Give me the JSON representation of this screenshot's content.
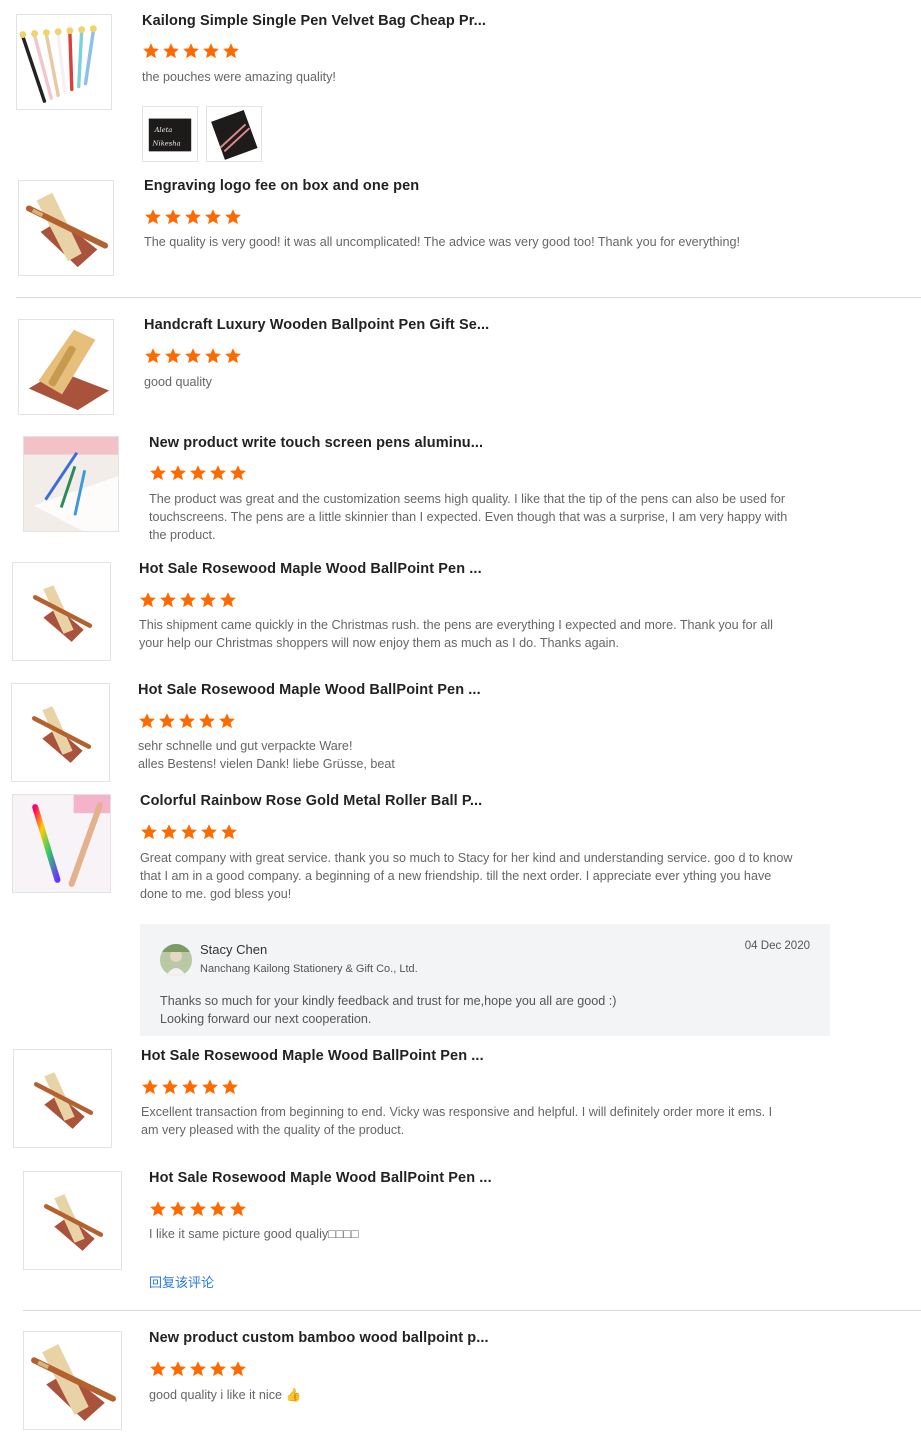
{
  "reviews": [
    {
      "title": "Kailong Simple Single Pen Velvet Bag Cheap Pr...",
      "rating": 5,
      "text": "the pouches were amazing quality!",
      "thumb": "pens-fan",
      "photos": [
        "velvet-bag-engraved-photo",
        "velvet-bag-pens-photo"
      ]
    },
    {
      "title": "Engraving logo fee on box and one pen",
      "rating": 5,
      "text": "The quality is very good! it was all uncomplicated! The advice was very good too! Thank you for everything!",
      "thumb": "wood-stand"
    },
    {
      "title": "Handcraft Luxury Wooden Ballpoint Pen Gift Se...",
      "rating": 5,
      "text": "good quality",
      "thumb": "bamboo-stand"
    },
    {
      "title": "New product write touch screen pens aluminu...",
      "rating": 5,
      "text": "The product was great and the customization seems high quality. I like that the tip of the pens can also be used for touchscreens. The pens are a little skinnier than I expected. Even though that was a surprise, I am very happy with the product.",
      "thumb": "touch-pens"
    },
    {
      "title": "Hot Sale Rosewood Maple Wood BallPoint Pen ...",
      "rating": 5,
      "text": "This shipment came quickly in the Christmas rush. the pens are everything I expected and more. Thank you for all your help our Christmas shoppers will now enjoy them as much as I do. Thanks again.",
      "thumb": "wood-stand-small"
    },
    {
      "title": "Hot Sale Rosewood Maple Wood BallPoint Pen ...",
      "rating": 5,
      "text": "sehr schnelle und gut verpackte Ware!\nalles Bestens! vielen Dank! liebe Grüsse, beat",
      "thumb": "wood-stand-small"
    },
    {
      "title": "Colorful Rainbow Rose Gold Metal Roller Ball P...",
      "rating": 5,
      "text": "Great company with great service. thank you so much to Stacy for her kind and understanding service. goo d to know that I am in a good company. a beginning of a new friendship. till the next order. I appreciate ever ything you have done to me. god bless you!",
      "thumb": "rainbow-pens"
    },
    {
      "title": "Hot Sale Rosewood Maple Wood BallPoint Pen ...",
      "rating": 5,
      "text": "Excellent transaction from beginning to end. Vicky was responsive and helpful. I will definitely order more it ems. I am very pleased with the quality of the product.",
      "thumb": "wood-stand-small"
    },
    {
      "title": "Hot Sale Rosewood Maple Wood BallPoint Pen ...",
      "rating": 5,
      "text": "I like it same picture good qualiy□□□□",
      "thumb": "wood-stand-small"
    },
    {
      "title": "New product custom bamboo wood ballpoint p...",
      "rating": 5,
      "text": "good quality i like it nice 👍",
      "thumb": "wood-stand"
    }
  ],
  "reply": {
    "name": "Stacy Chen",
    "company": "Nanchang Kailong Stationery & Gift Co., Ltd.",
    "date": "04 Dec 2020",
    "text": "Thanks so much for your kindly feedback and trust for me,hope you all are good :)\nLooking forward our next cooperation."
  },
  "reply_link": "回复该评论",
  "colors": {
    "star": "#ff6a00",
    "link": "#2a7ad9",
    "reply_bg": "#f3f4f6"
  },
  "icons": {
    "star": "star-icon"
  }
}
